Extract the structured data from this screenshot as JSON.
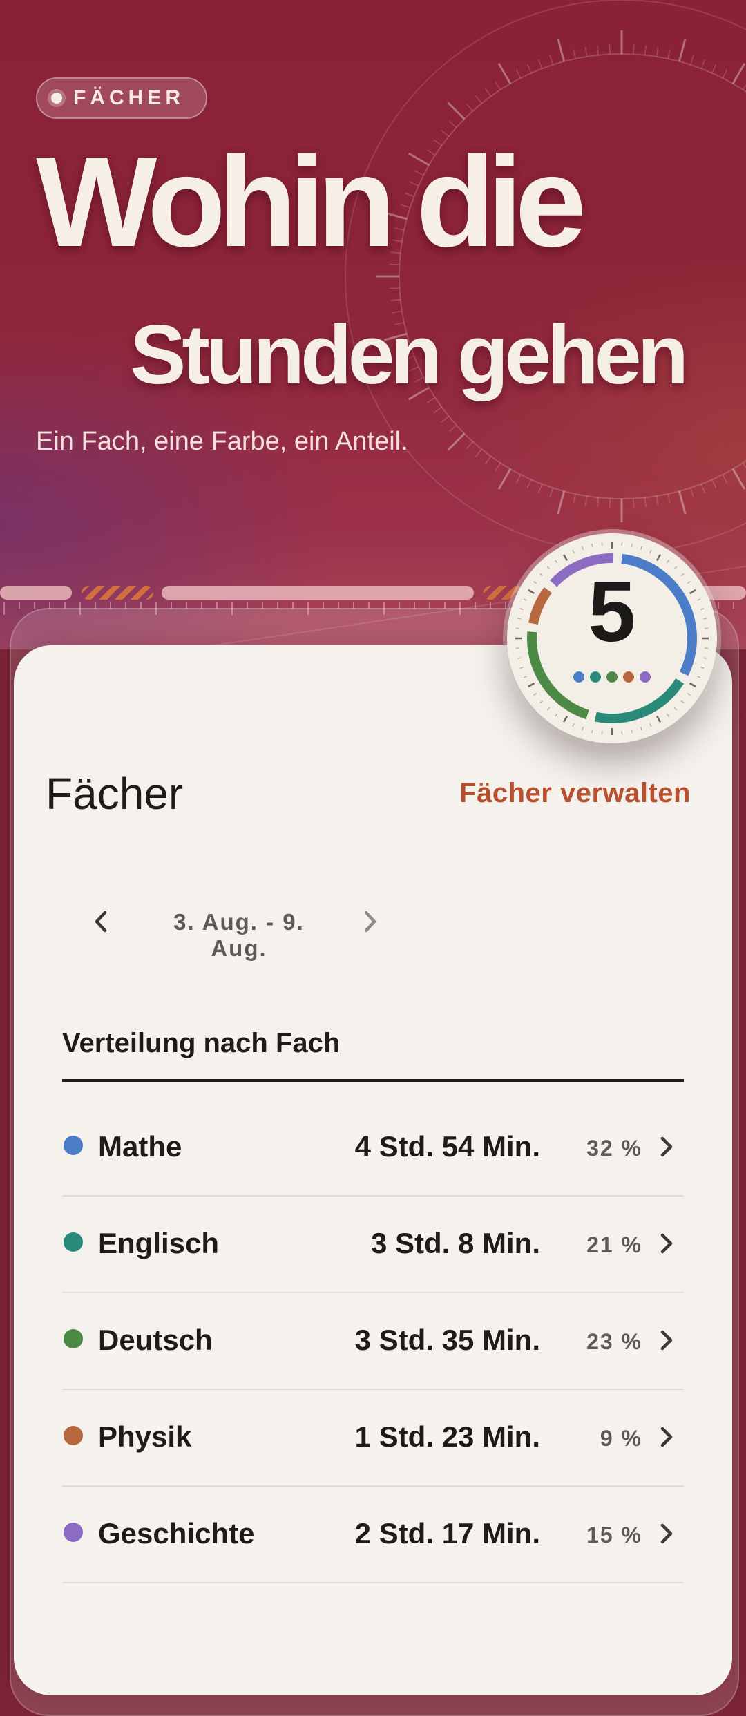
{
  "hero": {
    "pill_label": "FÄCHER",
    "title_line1": "Wohin die",
    "title_line2": "Stunden gehen",
    "subtitle": "Ein Fach, eine Farbe, ein Anteil."
  },
  "badge": {
    "count": "5"
  },
  "card": {
    "title": "Fächer",
    "manage_label": "Fächer verwalten",
    "week_label": "3. Aug. - 9. Aug.",
    "section_title": "Verteilung nach Fach"
  },
  "subjects": [
    {
      "name": "Mathe",
      "duration": "4 Std. 54 Min.",
      "percent": "32 %",
      "share": 0.32,
      "color": "#4a7cc7"
    },
    {
      "name": "Englisch",
      "duration": "3 Std. 8 Min.",
      "percent": "21 %",
      "share": 0.21,
      "color": "#2a8a7a"
    },
    {
      "name": "Deutsch",
      "duration": "3 Std. 35 Min.",
      "percent": "23 %",
      "share": 0.23,
      "color": "#4c8a45"
    },
    {
      "name": "Physik",
      "duration": "1 Std. 23 Min.",
      "percent": "9 %",
      "share": 0.09,
      "color": "#b8683e"
    },
    {
      "name": "Geschichte",
      "duration": "2 Std. 17 Min.",
      "percent": "15 %",
      "share": 0.15,
      "color": "#8c6cc2"
    }
  ],
  "icons": {
    "prev": "chevron-left-icon",
    "next": "chevron-right-icon",
    "row": "chevron-right-icon"
  }
}
